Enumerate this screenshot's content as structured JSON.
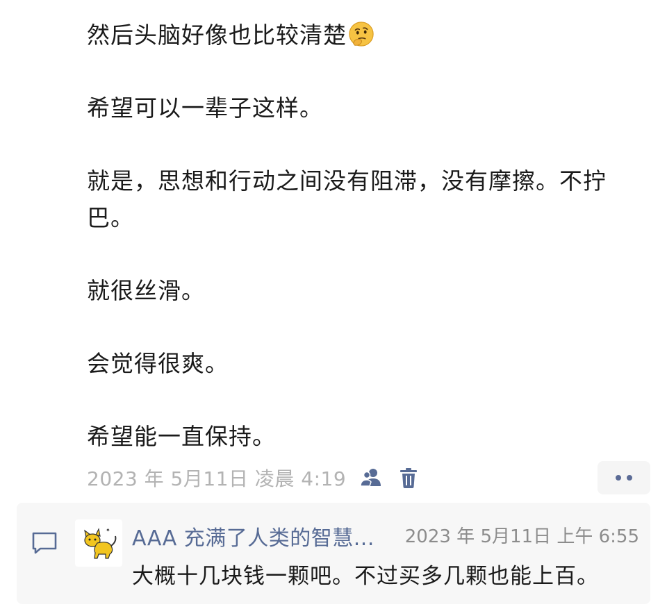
{
  "post": {
    "paragraphs": [
      "然后头脑好像也比较清楚",
      "希望可以一辈子这样。",
      "就是，思想和行动之间没有阻滞，没有摩擦。不拧巴。",
      "就很丝滑。",
      "会觉得很爽。",
      "希望能一直保持。"
    ],
    "emoji_icon": "thinking-face-emoji"
  },
  "meta": {
    "timestamp": "2023 年 5月11日 凌晨 4:19",
    "privacy_icon": "people-icon",
    "delete_icon": "trash-icon",
    "more_icon": "more-dots-icon",
    "accent_color": "#576b95"
  },
  "comment": {
    "section_icon": "comment-bubble-icon",
    "avatar_icon": "yellow-cat-avatar",
    "author": "AAA 充满了人类的智慧...",
    "time": "2023 年 5月11日 上午 6:55",
    "text": "大概十几块钱一颗吧。不过买多几颗也能上百。"
  }
}
